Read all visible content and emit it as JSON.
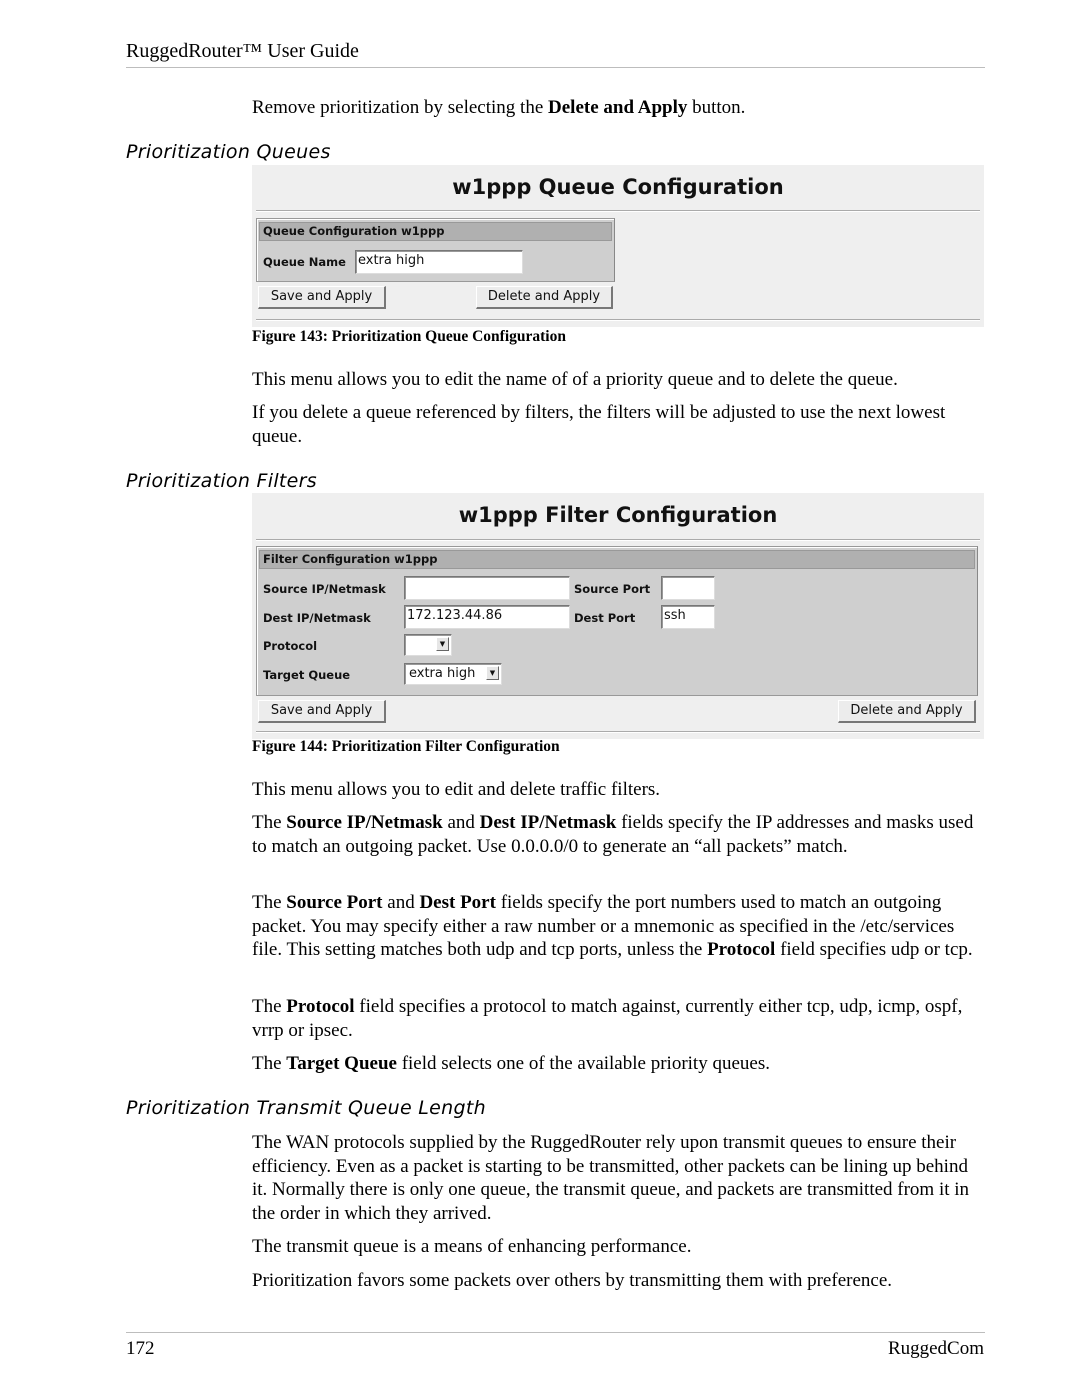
{
  "header": {
    "title": "RuggedRouter™ User Guide"
  },
  "intro": {
    "text_before": "Remove prioritization by selecting the ",
    "bold": "Delete and Apply",
    "text_after": " button."
  },
  "sections": {
    "queues": {
      "title": "Prioritization Queues",
      "figure": {
        "panel_title": "w1ppp Queue Configuration",
        "box_header": "Queue Configuration w1ppp",
        "queue_name_label": "Queue Name",
        "queue_name_value": "extra high",
        "save_button": "Save and Apply",
        "delete_button": "Delete and Apply",
        "caption": "Figure 143:  Prioritization Queue Configuration"
      },
      "paragraphs": [
        "This menu allows you to edit the name of of a priority queue and to delete the queue.",
        "If you delete a queue referenced by filters, the filters will be adjusted to use the next lowest queue."
      ]
    },
    "filters": {
      "title": "Prioritization Filters",
      "figure": {
        "panel_title": "w1ppp Filter Configuration",
        "box_header": "Filter Configuration w1ppp",
        "source_ip_label": "Source IP/Netmask",
        "source_ip_value": "",
        "source_port_label": "Source Port",
        "source_port_value": "",
        "dest_ip_label": "Dest IP/Netmask",
        "dest_ip_value": "172.123.44.86",
        "dest_port_label": "Dest Port",
        "dest_port_value": "ssh",
        "protocol_label": "Protocol",
        "protocol_value": "",
        "target_queue_label": "Target Queue",
        "target_queue_value": "extra high",
        "save_button": "Save and Apply",
        "delete_button": "Delete and Apply",
        "caption": "Figure 144:  Prioritization Filter Configuration"
      },
      "p1": "This menu allows you to edit and delete traffic filters.",
      "p2": {
        "t1": "The ",
        "b1": "Source IP/Netmask",
        "t2": " and ",
        "b2": "Dest IP/Netmask",
        "t3": " fields specify the IP addresses and masks used to match an outgoing packet.  Use 0.0.0.0/0 to generate an “all packets” match."
      },
      "p3": {
        "t1": "The ",
        "b1": "Source Port",
        "t2": " and ",
        "b2": "Dest Port",
        "t3": " fields specify the port numbers used to match an outgoing packet.  You may specify either a raw number or a mnemonic as specified in the /etc/services file.   This setting matches both udp and tcp ports, unless the ",
        "b3": "Protocol",
        "t4": " field specifies udp or tcp."
      },
      "p4": {
        "t1": "The ",
        "b1": "Protocol",
        "t2": " field specifies a protocol to match against, currently either tcp, udp, icmp, ospf, vrrp or ipsec."
      },
      "p5": {
        "t1": "The ",
        "b1": "Target Queue",
        "t2": " field selects one of the available priority queues."
      }
    },
    "transmit": {
      "title": "Prioritization Transmit Queue Length",
      "paragraphs": [
        "The WAN protocols supplied by the RuggedRouter rely upon transmit queues to ensure their efficiency.  Even as a packet is starting to be transmitted, other packets can be lining up behind it.  Normally there is only one queue, the transmit queue, and packets are transmitted from it in the order in which they arrived.",
        "The transmit queue is a means of enhancing performance.",
        "Prioritization favors some packets over others by transmitting them with preference."
      ]
    }
  },
  "footer": {
    "page_number": "172",
    "brand": "RuggedCom"
  }
}
